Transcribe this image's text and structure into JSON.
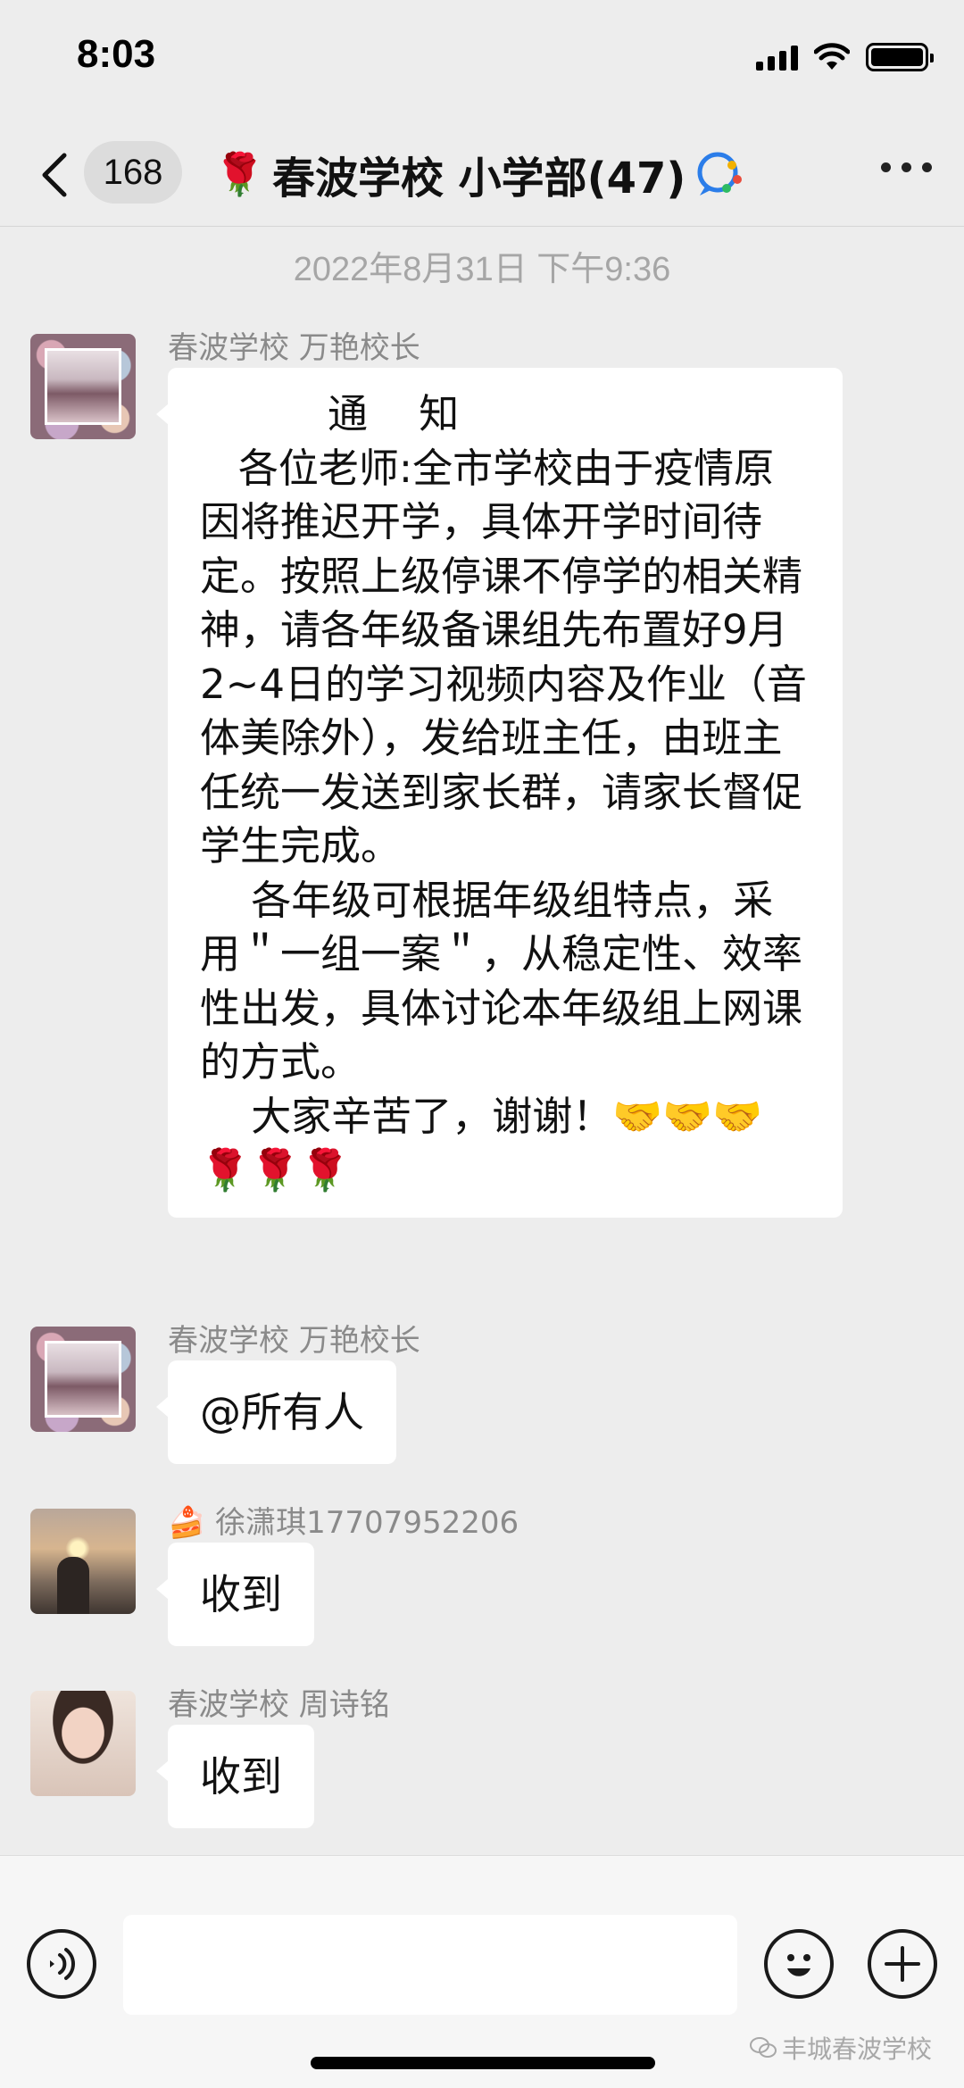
{
  "status_bar": {
    "time": "8:03"
  },
  "nav": {
    "back_count": "168",
    "title_emoji": "🌹",
    "title": "春波学校 小学部(47)"
  },
  "timestamp": "2022年8月31日 下午9:36",
  "messages": [
    {
      "sender": "春波学校 万艳校长",
      "text": "          通    知\n   各位老师:全市学校由于疫情原因将推迟开学，具体开学时间待定。按照上级停课不停学的相关精神，请各年级备课组先布置好9月2~4日的学习视频内容及作业（音体美除外），发给班主任，由班主任统一发送到家长群，请家长督促学生完成。\n    各年级可根据年级组特点，采用＂一组一案＂，从稳定性、效率性出发，具体讨论本年级组上网课的方式。\n    大家辛苦了，谢谢！🤝🤝🤝🌹🌹🌹"
    },
    {
      "sender": "春波学校 万艳校长",
      "text": "@所有人"
    },
    {
      "sender_emoji": "🍰",
      "sender": "徐潇琪17707952206",
      "text": "收到"
    },
    {
      "sender": "春波学校 周诗铭",
      "text": "收到"
    }
  ],
  "input": {
    "placeholder": ""
  },
  "watermark": "丰城春波学校",
  "icons": {
    "back": "chevron-left-icon",
    "wecom": "wecom-chat-icon",
    "more": "more-dots-icon",
    "voice": "voice-icon",
    "emoji": "smiley-icon",
    "add": "plus-icon"
  }
}
